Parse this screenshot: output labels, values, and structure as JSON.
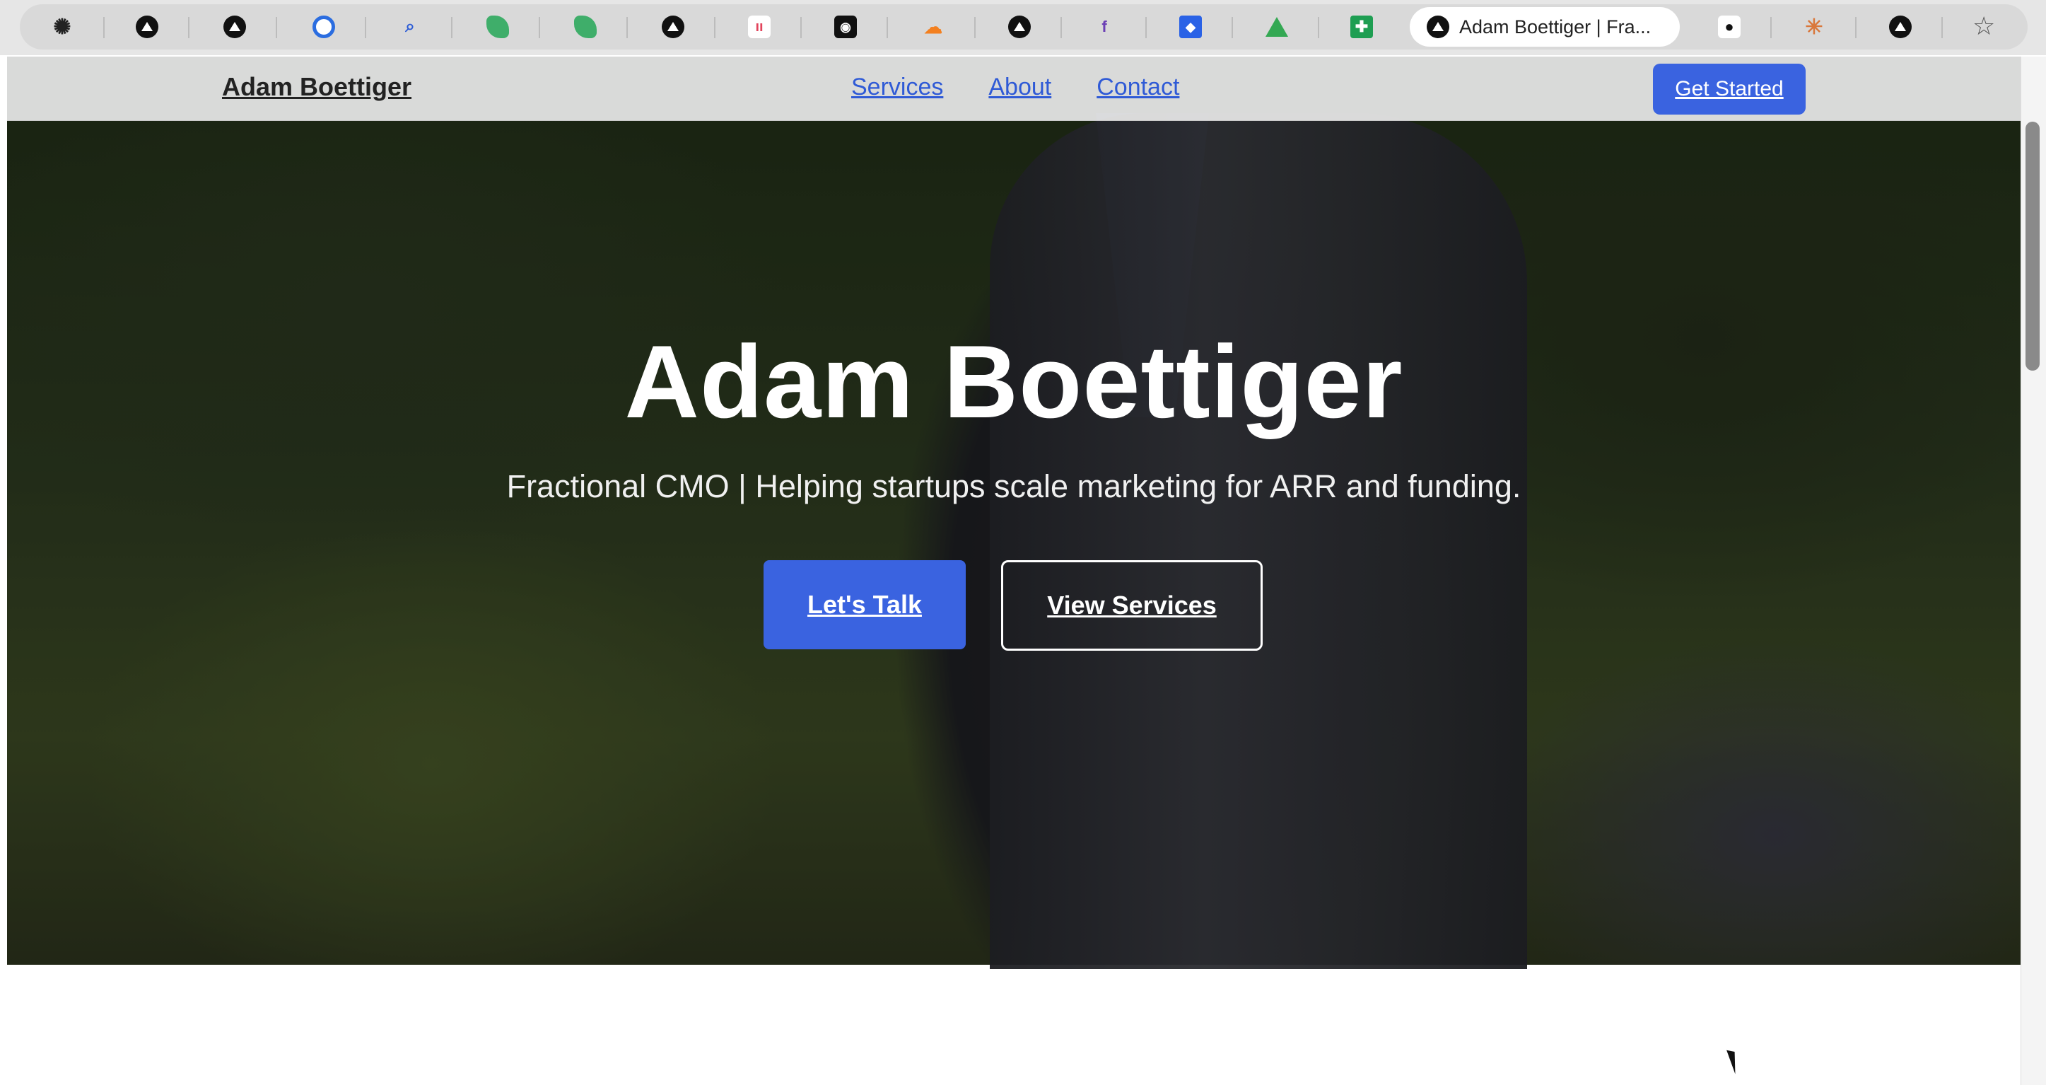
{
  "browser": {
    "tabs": [
      {
        "icon": "openai-icon"
      },
      {
        "icon": "vercel-icon"
      },
      {
        "icon": "vercel-icon"
      },
      {
        "icon": "grammarly-icon"
      },
      {
        "icon": "search-icon"
      },
      {
        "icon": "leaf-icon"
      },
      {
        "icon": "leaf-icon"
      },
      {
        "icon": "vercel-icon"
      },
      {
        "icon": "monday-icon"
      },
      {
        "icon": "github-icon"
      },
      {
        "icon": "cloudflare-icon"
      },
      {
        "icon": "vercel-icon"
      },
      {
        "icon": "freecodecamp-icon"
      },
      {
        "icon": "dropbox-icon"
      },
      {
        "icon": "google-drive-icon"
      },
      {
        "icon": "google-sheets-icon"
      }
    ],
    "active_tab": {
      "icon": "vercel-icon",
      "title": "Adam Boettiger | Fra..."
    },
    "after_tabs": [
      {
        "icon": "apple-icon"
      },
      {
        "icon": "claude-icon"
      },
      {
        "icon": "vercel-icon"
      }
    ]
  },
  "header": {
    "brand": "Adam Boettiger",
    "nav": [
      "Services",
      "About",
      "Contact"
    ],
    "cta": "Get Started"
  },
  "hero": {
    "title": "Adam Boettiger",
    "subtitle": "Fractional CMO | Helping startups scale marketing for ARR and funding.",
    "primary_button": "Let's Talk",
    "secondary_button": "View Services"
  },
  "colors": {
    "accent": "#3a63e0",
    "link": "#2f5ad6"
  }
}
